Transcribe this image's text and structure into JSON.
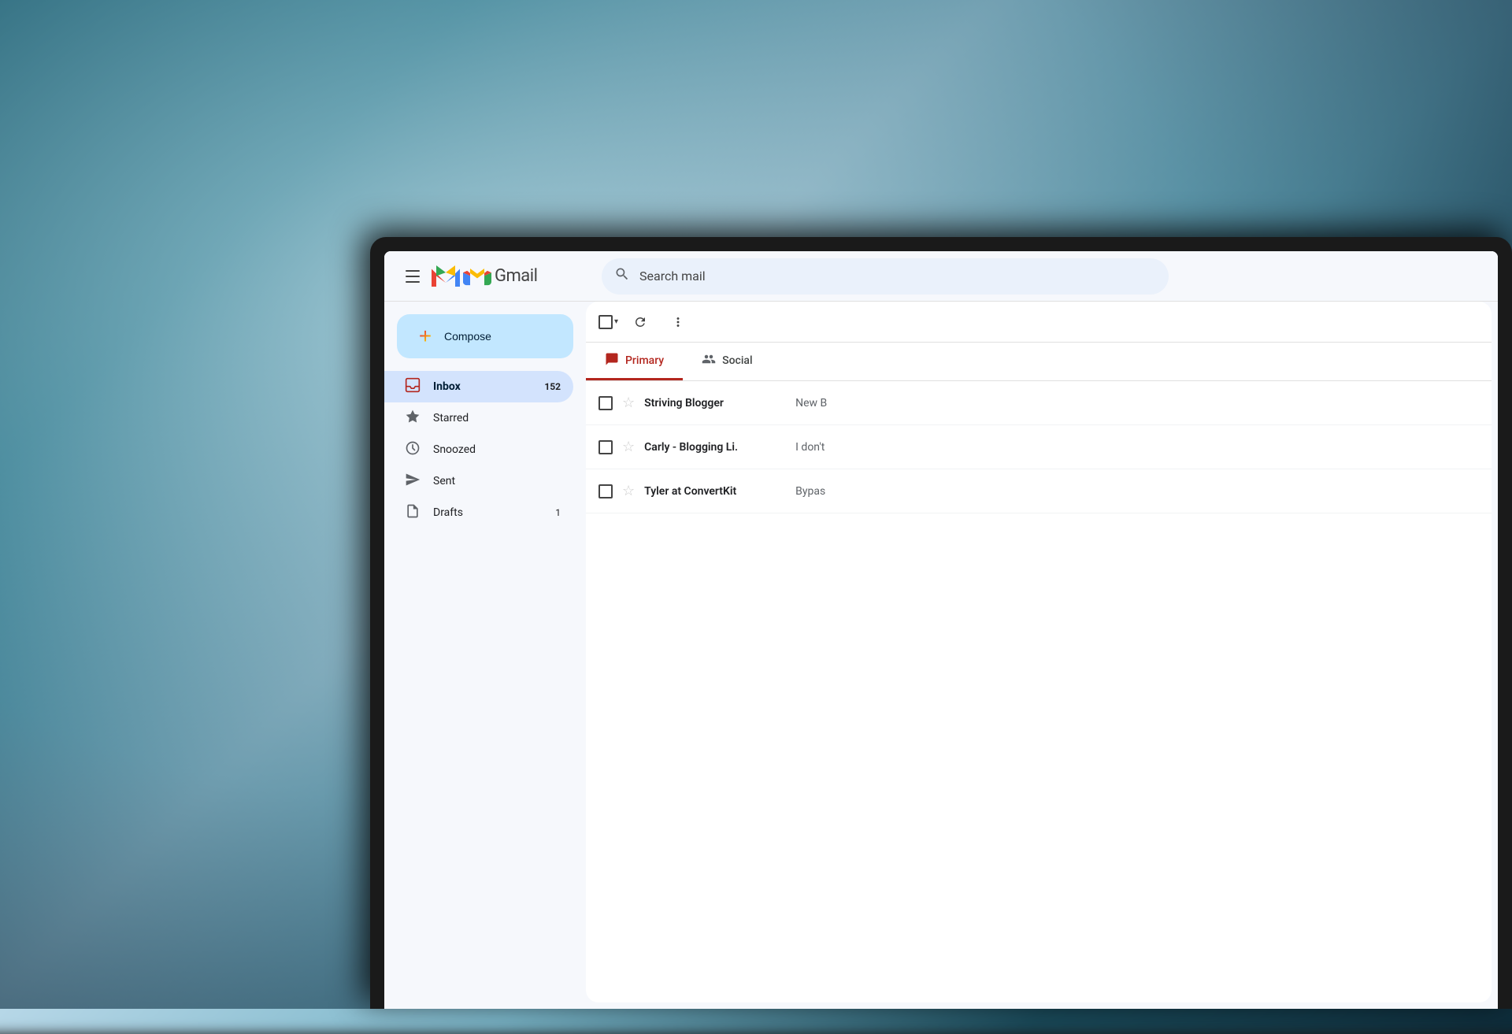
{
  "background": {
    "description": "Blurred teal/blue ocean wave background"
  },
  "topbar": {
    "menu_label": "Main menu",
    "logo_text": "Gmail",
    "search_placeholder": "Search mail"
  },
  "sidebar": {
    "compose_label": "Compose",
    "nav_items": [
      {
        "id": "inbox",
        "label": "Inbox",
        "icon": "inbox",
        "badge": "152",
        "active": true
      },
      {
        "id": "starred",
        "label": "Starred",
        "icon": "star",
        "badge": "",
        "active": false
      },
      {
        "id": "snoozed",
        "label": "Snoozed",
        "icon": "clock",
        "badge": "",
        "active": false
      },
      {
        "id": "sent",
        "label": "Sent",
        "icon": "send",
        "badge": "",
        "active": false
      },
      {
        "id": "drafts",
        "label": "Drafts",
        "icon": "draft",
        "badge": "1",
        "active": false
      }
    ]
  },
  "toolbar": {
    "select_all_label": "Select all",
    "refresh_label": "Refresh",
    "more_label": "More"
  },
  "tabs": [
    {
      "id": "primary",
      "label": "Primary",
      "icon": "chat",
      "active": true
    },
    {
      "id": "social",
      "label": "Social",
      "icon": "people",
      "active": false
    }
  ],
  "emails": [
    {
      "sender": "Striving Blogger",
      "snippet": "New B",
      "starred": false
    },
    {
      "sender": "Carly - Blogging Li.",
      "snippet": "I don't",
      "starred": false
    },
    {
      "sender": "Tyler at ConvertKit",
      "snippet": "Bypas",
      "starred": false
    }
  ]
}
